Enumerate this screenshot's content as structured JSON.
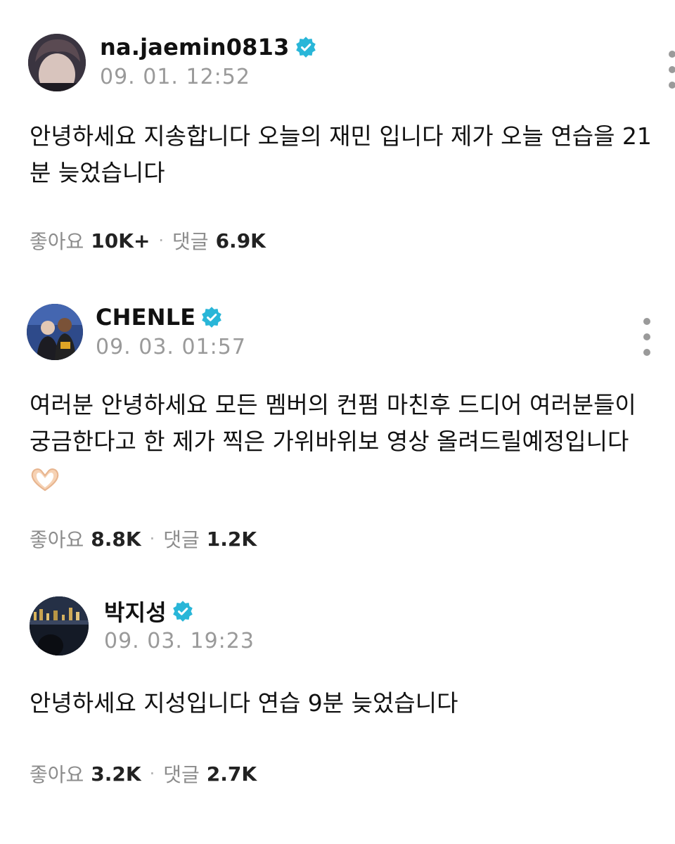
{
  "posts": [
    {
      "username": "na.jaemin0813",
      "timestamp": "09. 01. 12:52",
      "verified_icon": "verified-badge-icon",
      "text": "안녕하세요 지송합니다 오늘의 재민 입니다 제가 오늘 연습을 21분 늦었습니다",
      "emoji": "",
      "likes_label": "좋아요",
      "likes": "10K+",
      "comments_label": "댓글",
      "comments": "6.9K"
    },
    {
      "username": "CHENLE",
      "timestamp": "09. 03. 01:57",
      "verified_icon": "verified-badge-icon",
      "text": "여러분 안녕하세요 모든 멤버의 컨펌 마친후 드디어 여러분들이 궁금한다고 한 제가 찍은 가위바위보 영상 올려드릴예정입니다",
      "emoji": "heart-hands-emoji",
      "likes_label": "좋아요",
      "likes": "8.8K",
      "comments_label": "댓글",
      "comments": "1.2K"
    },
    {
      "username": "박지성",
      "timestamp": "09. 03. 19:23",
      "verified_icon": "verified-badge-icon",
      "text": "안녕하세요 지성입니다 연습 9분 늦었습니다",
      "emoji": "",
      "likes_label": "좋아요",
      "likes": "3.2K",
      "comments_label": "댓글",
      "comments": "2.7K"
    }
  ],
  "colors": {
    "verified": "#29b6d8",
    "muted": "#9a9a9a",
    "text": "#111111"
  }
}
